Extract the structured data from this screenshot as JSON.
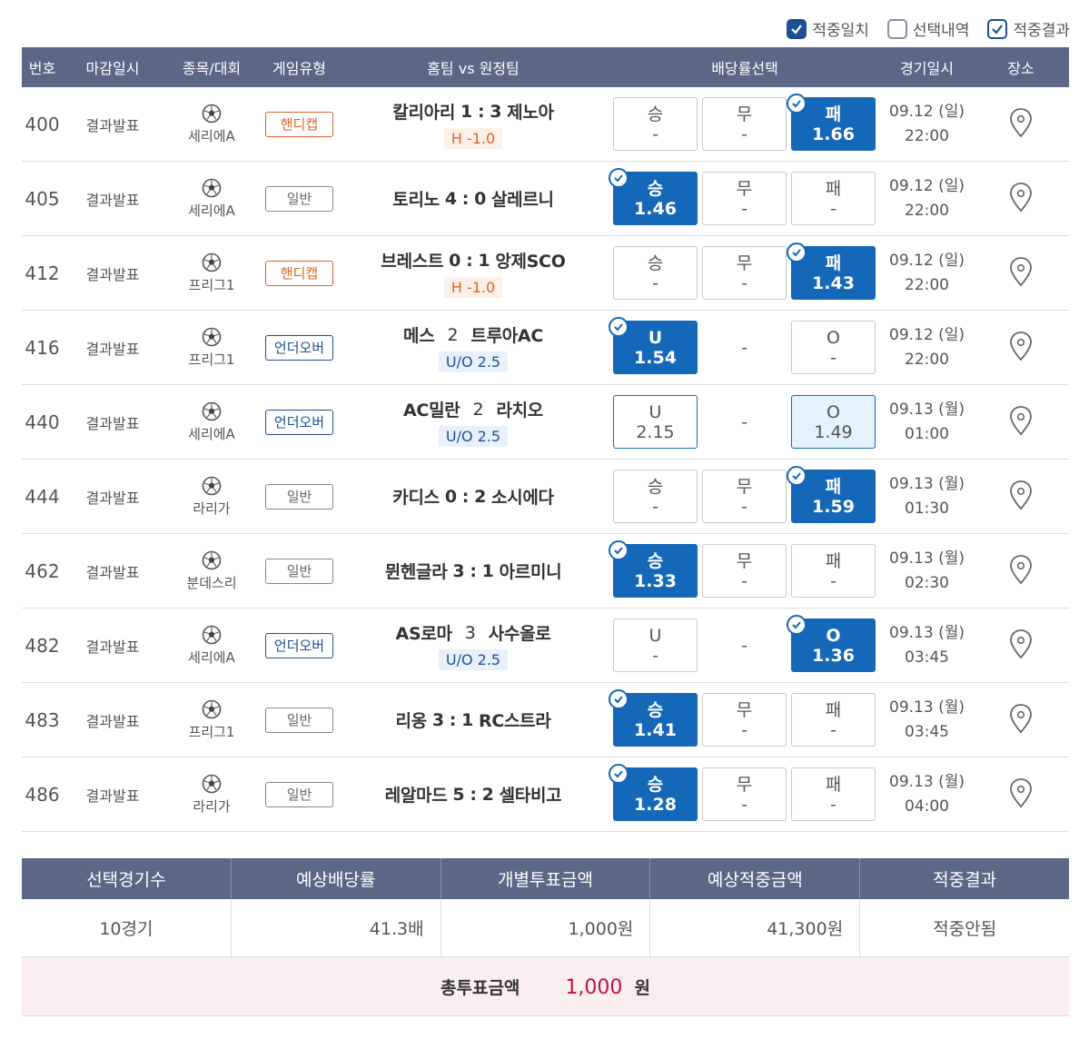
{
  "legend": [
    {
      "label": "적중일치",
      "state": "on"
    },
    {
      "label": "선택내역",
      "state": "off"
    },
    {
      "label": "적중결과",
      "state": "outline"
    }
  ],
  "headers": {
    "num": "번호",
    "close": "마감일시",
    "league": "종목/대회",
    "type": "게임유형",
    "match": "홈팀 vs 원정팀",
    "odds": "배당률선택",
    "date": "경기일시",
    "place": "장소"
  },
  "rows": [
    {
      "num": "400",
      "close": "결과발표",
      "league": "세리에A",
      "type": "핸디캡",
      "type_kind": "hc",
      "home": "칼리아리",
      "home_score": "1",
      "away_score": "3",
      "away": "제노아",
      "sub": "H -1.0",
      "odds": [
        {
          "lbl": "승",
          "val": "-",
          "state": "none"
        },
        {
          "lbl": "무",
          "val": "-",
          "state": "none"
        },
        {
          "lbl": "패",
          "val": "1.66",
          "state": "sel"
        }
      ],
      "date": "09.12 (일)",
      "time": "22:00"
    },
    {
      "num": "405",
      "close": "결과발표",
      "league": "세리에A",
      "type": "일반",
      "type_kind": "gen",
      "home": "토리노",
      "home_score": "4",
      "away_score": "0",
      "away": "살레르니",
      "sub": "",
      "odds": [
        {
          "lbl": "승",
          "val": "1.46",
          "state": "sel"
        },
        {
          "lbl": "무",
          "val": "-",
          "state": "none"
        },
        {
          "lbl": "패",
          "val": "-",
          "state": "none"
        }
      ],
      "date": "09.12 (일)",
      "time": "22:00"
    },
    {
      "num": "412",
      "close": "결과발표",
      "league": "프리그1",
      "type": "핸디캡",
      "type_kind": "hc",
      "home": "브레스트",
      "home_score": "0",
      "away_score": "1",
      "away": "앙제SCO",
      "sub": "H -1.0",
      "odds": [
        {
          "lbl": "승",
          "val": "-",
          "state": "none"
        },
        {
          "lbl": "무",
          "val": "-",
          "state": "none"
        },
        {
          "lbl": "패",
          "val": "1.43",
          "state": "sel"
        }
      ],
      "date": "09.12 (일)",
      "time": "22:00"
    },
    {
      "num": "416",
      "close": "결과발표",
      "league": "프리그1",
      "type": "언더오버",
      "type_kind": "uo",
      "home": "메스",
      "home_score": "2",
      "away_score": "",
      "away": "트루아AC",
      "sub": "U/O 2.5",
      "odds": [
        {
          "lbl": "U",
          "val": "1.54",
          "state": "sel"
        },
        {
          "lbl": "",
          "val": "-",
          "state": "empty"
        },
        {
          "lbl": "O",
          "val": "-",
          "state": "none"
        }
      ],
      "date": "09.12 (일)",
      "time": "22:00"
    },
    {
      "num": "440",
      "close": "결과발표",
      "league": "세리에A",
      "type": "언더오버",
      "type_kind": "uo",
      "home": "AC밀란",
      "home_score": "2",
      "away_score": "",
      "away": "라치오",
      "sub": "U/O 2.5",
      "odds": [
        {
          "lbl": "U",
          "val": "2.15",
          "state": "blue"
        },
        {
          "lbl": "",
          "val": "-",
          "state": "empty"
        },
        {
          "lbl": "O",
          "val": "1.49",
          "state": "light"
        }
      ],
      "date": "09.13 (월)",
      "time": "01:00"
    },
    {
      "num": "444",
      "close": "결과발표",
      "league": "라리가",
      "type": "일반",
      "type_kind": "gen",
      "home": "카디스",
      "home_score": "0",
      "away_score": "2",
      "away": "소시에다",
      "sub": "",
      "odds": [
        {
          "lbl": "승",
          "val": "-",
          "state": "none"
        },
        {
          "lbl": "무",
          "val": "-",
          "state": "none"
        },
        {
          "lbl": "패",
          "val": "1.59",
          "state": "sel"
        }
      ],
      "date": "09.13 (월)",
      "time": "01:30"
    },
    {
      "num": "462",
      "close": "결과발표",
      "league": "분데스리",
      "type": "일반",
      "type_kind": "gen",
      "home": "뮌헨글라",
      "home_score": "3",
      "away_score": "1",
      "away": "아르미니",
      "sub": "",
      "odds": [
        {
          "lbl": "승",
          "val": "1.33",
          "state": "sel"
        },
        {
          "lbl": "무",
          "val": "-",
          "state": "none"
        },
        {
          "lbl": "패",
          "val": "-",
          "state": "none"
        }
      ],
      "date": "09.13 (월)",
      "time": "02:30"
    },
    {
      "num": "482",
      "close": "결과발표",
      "league": "세리에A",
      "type": "언더오버",
      "type_kind": "uo",
      "home": "AS로마",
      "home_score": "3",
      "away_score": "",
      "away": "사수올로",
      "sub": "U/O 2.5",
      "odds": [
        {
          "lbl": "U",
          "val": "-",
          "state": "none"
        },
        {
          "lbl": "",
          "val": "-",
          "state": "empty"
        },
        {
          "lbl": "O",
          "val": "1.36",
          "state": "sel"
        }
      ],
      "date": "09.13 (월)",
      "time": "03:45"
    },
    {
      "num": "483",
      "close": "결과발표",
      "league": "프리그1",
      "type": "일반",
      "type_kind": "gen",
      "home": "리옹",
      "home_score": "3",
      "away_score": "1",
      "away": "RC스트라",
      "sub": "",
      "odds": [
        {
          "lbl": "승",
          "val": "1.41",
          "state": "sel"
        },
        {
          "lbl": "무",
          "val": "-",
          "state": "none"
        },
        {
          "lbl": "패",
          "val": "-",
          "state": "none"
        }
      ],
      "date": "09.13 (월)",
      "time": "03:45"
    },
    {
      "num": "486",
      "close": "결과발표",
      "league": "라리가",
      "type": "일반",
      "type_kind": "gen",
      "home": "레알마드",
      "home_score": "5",
      "away_score": "2",
      "away": "셀타비고",
      "sub": "",
      "odds": [
        {
          "lbl": "승",
          "val": "1.28",
          "state": "sel"
        },
        {
          "lbl": "무",
          "val": "-",
          "state": "none"
        },
        {
          "lbl": "패",
          "val": "-",
          "state": "none"
        }
      ],
      "date": "09.13 (월)",
      "time": "04:00"
    }
  ],
  "summary": {
    "headers": [
      "선택경기수",
      "예상배당률",
      "개별투표금액",
      "예상적중금액",
      "적중결과"
    ],
    "values": [
      "10경기",
      "41.3배",
      "1,000원",
      "41,300원",
      "적중안됨"
    ],
    "total_label": "총투표금액",
    "total_value": "1,000",
    "total_unit": "원"
  },
  "colors": {
    "header_bg": "#5c6785",
    "selected": "#1567b8",
    "handicap": "#d9632c",
    "total_value": "#c0143c"
  }
}
